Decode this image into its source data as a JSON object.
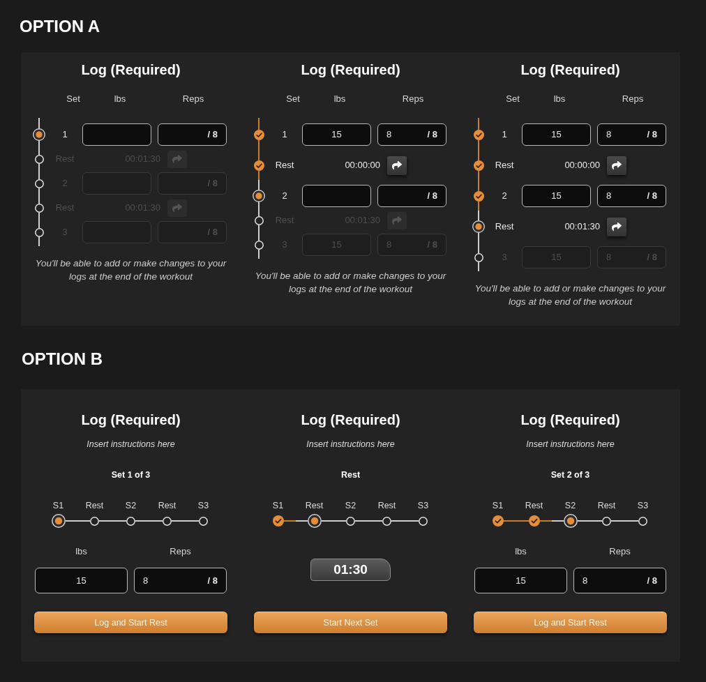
{
  "option_a": {
    "heading": "OPTION A",
    "cards": [
      {
        "title": "Log (Required)",
        "columns": [
          "Set",
          "lbs",
          "Reps"
        ],
        "steps": [
          {
            "kind": "set",
            "label": "1",
            "completed": false,
            "selected": true,
            "disabled": false,
            "target": "/ 8"
          },
          {
            "kind": "rest",
            "label": "Rest",
            "completed": false,
            "selected": false,
            "disabled": true,
            "time": "00:01:30"
          },
          {
            "kind": "set",
            "label": "2",
            "completed": false,
            "selected": false,
            "disabled": true,
            "target": "/ 8"
          },
          {
            "kind": "rest",
            "label": "Rest",
            "completed": false,
            "selected": false,
            "disabled": true,
            "time": "00:01:30"
          },
          {
            "kind": "set",
            "label": "3",
            "completed": false,
            "selected": false,
            "disabled": true,
            "target": "/ 8"
          }
        ],
        "note": "You'll be able to add or make changes to your logs at the end of the workout"
      },
      {
        "title": "Log (Required)",
        "columns": [
          "Set",
          "lbs",
          "Reps"
        ],
        "steps": [
          {
            "kind": "set",
            "label": "1",
            "completed": true,
            "selected": false,
            "disabled": false,
            "lbs": "15",
            "reps": "8",
            "target": "/ 8"
          },
          {
            "kind": "rest",
            "label": "Rest",
            "completed": true,
            "selected": false,
            "disabled": false,
            "time": "00:00:00"
          },
          {
            "kind": "set",
            "label": "2",
            "completed": false,
            "selected": true,
            "disabled": false,
            "target": "/ 8"
          },
          {
            "kind": "rest",
            "label": "Rest",
            "completed": false,
            "selected": false,
            "disabled": true,
            "time": "00:01:30"
          },
          {
            "kind": "set",
            "label": "3",
            "completed": false,
            "selected": false,
            "disabled": true,
            "lbs": "15",
            "reps": "8",
            "target": "/ 8"
          }
        ],
        "note": "You'll be able to add or make changes to your logs at the end of the workout"
      },
      {
        "title": "Log (Required)",
        "columns": [
          "Set",
          "lbs",
          "Reps"
        ],
        "steps": [
          {
            "kind": "set",
            "label": "1",
            "completed": true,
            "selected": false,
            "disabled": false,
            "lbs": "15",
            "reps": "8",
            "target": "/ 8"
          },
          {
            "kind": "rest",
            "label": "Rest",
            "completed": true,
            "selected": false,
            "disabled": false,
            "time": "00:00:00"
          },
          {
            "kind": "set",
            "label": "2",
            "completed": true,
            "selected": false,
            "disabled": false,
            "lbs": "15",
            "reps": "8",
            "target": "/ 8"
          },
          {
            "kind": "rest",
            "label": "Rest",
            "completed": false,
            "selected": true,
            "disabled": false,
            "time": "00:01:30"
          },
          {
            "kind": "set",
            "label": "3",
            "completed": false,
            "selected": false,
            "disabled": true,
            "lbs": "15",
            "reps": "8",
            "target": "/ 8"
          }
        ],
        "note": "You'll be able to add or make changes to your logs at the end of the workout"
      }
    ]
  },
  "option_b": {
    "heading": "OPTION B",
    "cards": [
      {
        "kind": "log",
        "title": "Log (Required)",
        "instructions": "Insert instructions here",
        "phase": "Set 1 of 3",
        "steps": [
          {
            "label": "S1",
            "completed": false,
            "selected": true
          },
          {
            "label": "Rest",
            "completed": false,
            "selected": false
          },
          {
            "label": "S2",
            "completed": false,
            "selected": false
          },
          {
            "label": "Rest",
            "completed": false,
            "selected": false
          },
          {
            "label": "S3",
            "completed": false,
            "selected": false
          }
        ],
        "lbs_label": "lbs",
        "reps_label": "Reps",
        "lbs": "15",
        "reps": "8",
        "target": "/ 8",
        "button": "Log and Start Rest"
      },
      {
        "kind": "rest",
        "title": "Log (Required)",
        "instructions": "Insert instructions here",
        "phase": "Rest",
        "steps": [
          {
            "label": "S1",
            "completed": true,
            "selected": false
          },
          {
            "label": "Rest",
            "completed": false,
            "selected": true
          },
          {
            "label": "S2",
            "completed": false,
            "selected": false
          },
          {
            "label": "Rest",
            "completed": false,
            "selected": false
          },
          {
            "label": "S3",
            "completed": false,
            "selected": false
          }
        ],
        "timer": "01:30",
        "button": "Start Next Set"
      },
      {
        "kind": "log",
        "title": "Log (Required)",
        "instructions": "Insert instructions here",
        "phase": "Set 2 of 3",
        "steps": [
          {
            "label": "S1",
            "completed": true,
            "selected": false
          },
          {
            "label": "Rest",
            "completed": true,
            "selected": false
          },
          {
            "label": "S2",
            "completed": false,
            "selected": true
          },
          {
            "label": "Rest",
            "completed": false,
            "selected": false
          },
          {
            "label": "S3",
            "completed": false,
            "selected": false
          }
        ],
        "lbs_label": "lbs",
        "reps_label": "Reps",
        "lbs": "15",
        "reps": "8",
        "target": "/ 8",
        "button": "Log and Start Rest"
      }
    ]
  }
}
